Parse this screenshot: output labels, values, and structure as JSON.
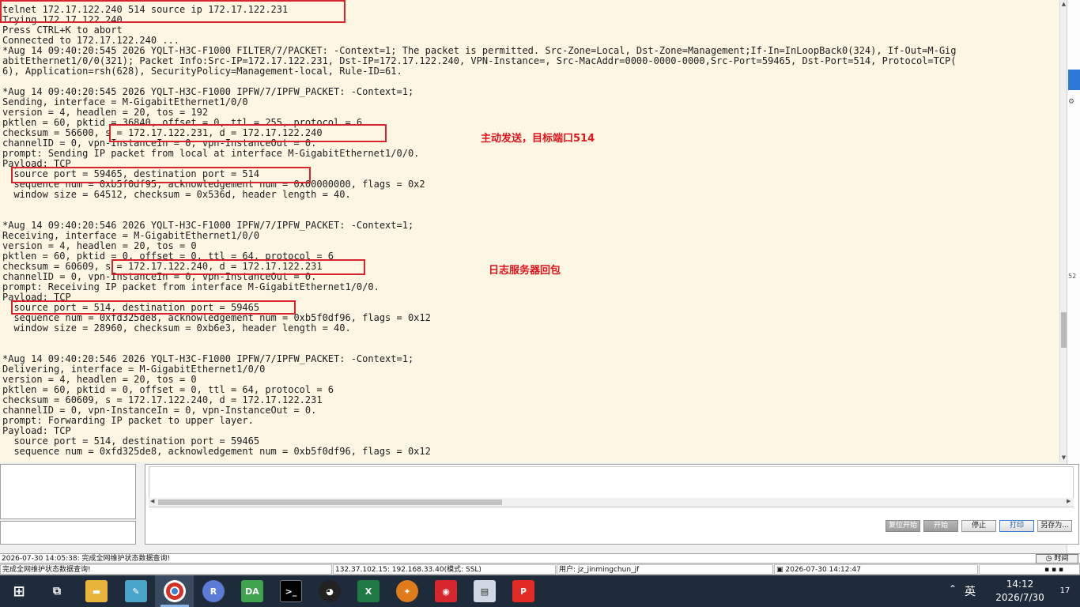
{
  "terminal": {
    "lines": [
      "telnet 172.17.122.240 514 source ip 172.17.122.231",
      "Trying 172.17.122.240 ...",
      "Press CTRL+K to abort",
      "Connected to 172.17.122.240 ...",
      "*Aug 14 09:40:20:545 2026 YQLT-H3C-F1000 FILTER/7/PACKET: -Context=1; The packet is permitted. Src-Zone=Local, Dst-Zone=Management;If-In=InLoopBack0(324), If-Out=M-Gig",
      "abitEthernet1/0/0(321); Packet Info:Src-IP=172.17.122.231, Dst-IP=172.17.122.240, VPN-Instance=, Src-MacAddr=0000-0000-0000,Src-Port=59465, Dst-Port=514, Protocol=TCP(",
      "6), Application=rsh(628), SecurityPolicy=Management-local, Rule-ID=61.",
      "",
      "*Aug 14 09:40:20:545 2026 YQLT-H3C-F1000 IPFW/7/IPFW_PACKET: -Context=1;",
      "Sending, interface = M-GigabitEthernet1/0/0",
      "version = 4, headlen = 20, tos = 192",
      "pktlen = 60, pktid = 36840, offset = 0, ttl = 255, protocol = 6",
      "checksum = 56600, s = 172.17.122.231, d = 172.17.122.240",
      "channelID = 0, vpn-InstanceIn = 0, vpn-InstanceOut = 0.",
      "prompt: Sending IP packet from local at interface M-GigabitEthernet1/0/0.",
      "Payload: TCP",
      "  source port = 59465, destination port = 514",
      "  sequence num = 0xb5f0df95, acknowledgement num = 0x00000000, flags = 0x2",
      "  window size = 64512, checksum = 0x536d, header length = 40.",
      "",
      "",
      "*Aug 14 09:40:20:546 2026 YQLT-H3C-F1000 IPFW/7/IPFW_PACKET: -Context=1;",
      "Receiving, interface = M-GigabitEthernet1/0/0",
      "version = 4, headlen = 20, tos = 0",
      "pktlen = 60, pktid = 0, offset = 0, ttl = 64, protocol = 6",
      "checksum = 60609, s = 172.17.122.240, d = 172.17.122.231",
      "channelID = 0, vpn-InstanceIn = 0, vpn-InstanceOut = 0.",
      "prompt: Receiving IP packet from interface M-GigabitEthernet1/0/0.",
      "Payload: TCP",
      "  source port = 514, destination port = 59465",
      "  sequence num = 0xfd325de8, acknowledgement num = 0xb5f0df96, flags = 0x12",
      "  window size = 28960, checksum = 0xb6e3, header length = 40.",
      "",
      "",
      "*Aug 14 09:40:20:546 2026 YQLT-H3C-F1000 IPFW/7/IPFW_PACKET: -Context=1;",
      "Delivering, interface = M-GigabitEthernet1/0/0",
      "version = 4, headlen = 20, tos = 0",
      "pktlen = 60, pktid = 0, offset = 0, ttl = 64, protocol = 6",
      "checksum = 60609, s = 172.17.122.240, d = 172.17.122.231",
      "channelID = 0, vpn-InstanceIn = 0, vpn-InstanceOut = 0.",
      "prompt: Forwarding IP packet to upper layer.",
      "Payload: TCP",
      "  source port = 514, destination port = 59465",
      "  sequence num = 0xfd325de8, acknowledgement num = 0xb5f0df96, flags = 0x12"
    ],
    "annotation_send": "主动发送，目标端口514",
    "annotation_reply": "日志服务器回包"
  },
  "right_strip": {
    "number": "52"
  },
  "buttons": {
    "reset_start": "复位开始",
    "start": "开始",
    "stop": "停止",
    "print": "打印",
    "save_as": "另存为..."
  },
  "status_bar": {
    "message": "2026-07-30 14:05:38: 完成全网维护状态数据查询!",
    "time_button": "时间",
    "left_text": "完成全网维护状态数据查询!",
    "server": "132.37.102.15: 192.168.33.40(模式: SSL)",
    "user": "用户: jz_jinmingchun_jf",
    "timestamp": "2026-07-30 14:12:47"
  },
  "taskbar": {
    "ime": "英",
    "time": "14:12",
    "date": "2026/7/30",
    "notification_count": "17"
  }
}
